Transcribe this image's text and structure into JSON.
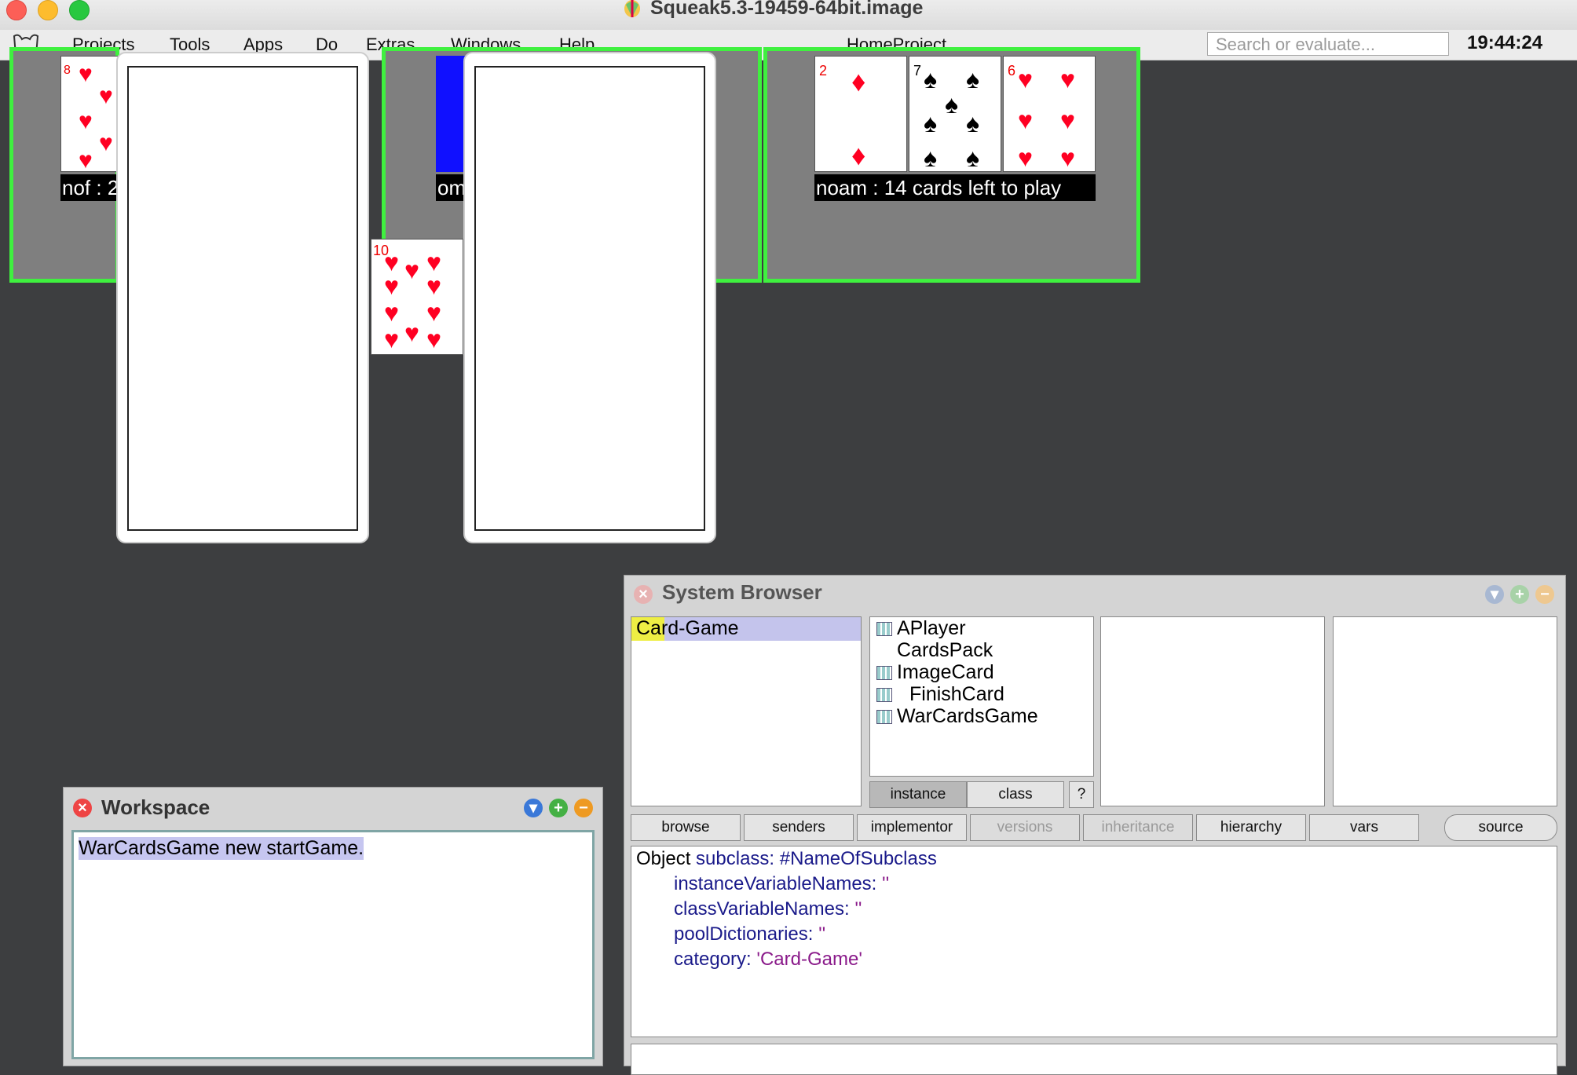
{
  "window": {
    "title": "Squeak5.3-19459-64bit.image"
  },
  "menubar": {
    "items": [
      "Projects",
      "Tools",
      "Apps",
      "Do",
      "Extras",
      "Windows",
      "Help"
    ],
    "project_name": "HomeProject",
    "search_placeholder": "Search or evaluate...",
    "clock": "19:44:24"
  },
  "game": {
    "player1": {
      "caption": "nof : 2",
      "top_card": {
        "rank": "8",
        "suit": "hearts"
      }
    },
    "player2": {
      "caption": "om",
      "card_back_color": "#1010ff"
    },
    "player3": {
      "caption": "noam : 14 cards left to play",
      "cards": [
        {
          "rank": "2",
          "suit": "diamonds"
        },
        {
          "rank": "7",
          "suit": "spades"
        },
        {
          "rank": "6",
          "suit": "hearts"
        }
      ]
    },
    "center_card": {
      "rank": "10",
      "suit": "hearts"
    },
    "highlight_color": "#3ff03f"
  },
  "workspace": {
    "title": "Workspace",
    "text": "WarCardsGame new startGame."
  },
  "browser": {
    "title": "System Browser",
    "categories": [
      "Card-Game"
    ],
    "classes": [
      {
        "name": "APlayer",
        "icon": "class-icon"
      },
      {
        "name": "CardsPack",
        "icon": ""
      },
      {
        "name": "ImageCard",
        "icon": "class-icon"
      },
      {
        "name": "FinishCard",
        "icon": "class-icon"
      },
      {
        "name": "WarCardsGame",
        "icon": "class-icon"
      }
    ],
    "toggle": {
      "instance": "instance",
      "class": "class",
      "help": "?"
    },
    "buttons": [
      "browse",
      "senders",
      "implementor",
      "versions",
      "inheritance",
      "hierarchy",
      "vars",
      "source"
    ],
    "disabled_buttons": [
      "versions",
      "inheritance"
    ],
    "code": {
      "l1_obj": "Object",
      "l1_msg": "subclass:",
      "l1_sym": "#NameOfSubclass",
      "l2_kw": "instanceVariableNames:",
      "l2_str": "''",
      "l3_kw": "classVariableNames:",
      "l3_str": "''",
      "l4_kw": "poolDictionaries:",
      "l4_str": "''",
      "l5_kw": "category:",
      "l5_str": "'Card-Game'"
    }
  }
}
